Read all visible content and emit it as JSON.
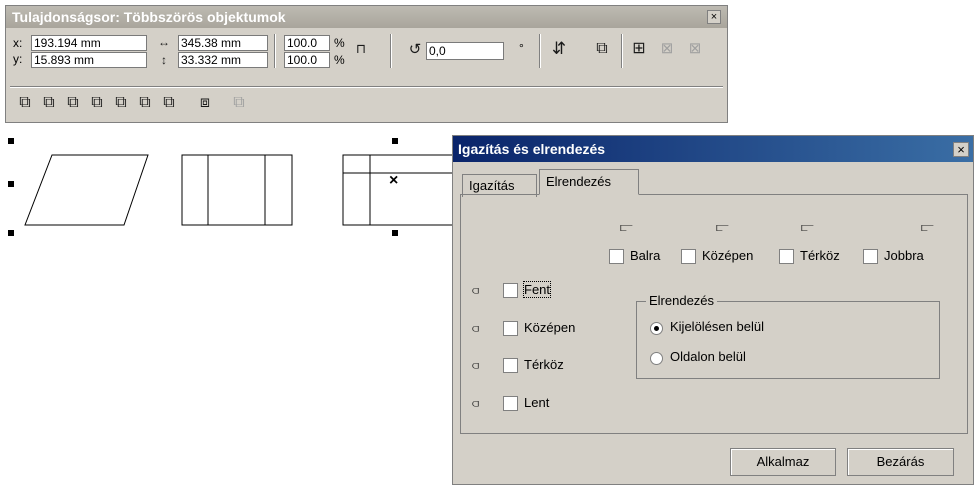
{
  "propbar": {
    "title": "Tulajdonságsor: Többszörös objektumok",
    "x_label": "x:",
    "x_value": "193.194 mm",
    "y_label": "y:",
    "y_value": "15.893 mm",
    "width_value": "345.38 mm",
    "height_value": "33.332 mm",
    "scale_x": "100.0",
    "scale_y": "100.0",
    "percent": "%",
    "rotation_value": "0,0",
    "degree": "°"
  },
  "dialog": {
    "title": "Igazítás és elrendezés",
    "tabs": [
      "Igazítás",
      "Elrendezés"
    ],
    "h_options": [
      "Balra",
      "Középen",
      "Térköz",
      "Jobbra"
    ],
    "v_options": [
      "Fent",
      "Középen",
      "Térköz",
      "Lent"
    ],
    "group_title": "Elrendezés",
    "radio_options": [
      "Kijelölésen belül",
      "Oldalon belül"
    ],
    "selected_radio": "Kijelölésen belül",
    "apply_label": "Alkalmaz",
    "close_label": "Bezárás",
    "close_x": "×"
  },
  "canvas": {
    "center_mark": "×"
  }
}
